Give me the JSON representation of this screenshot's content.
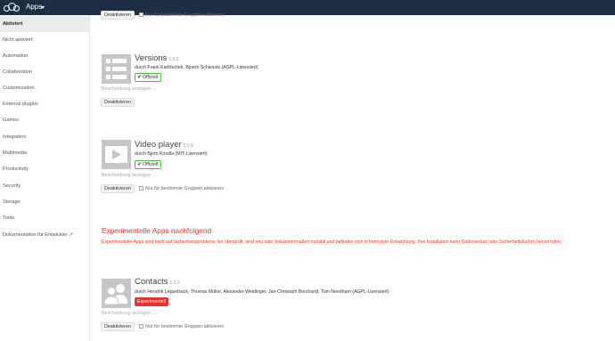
{
  "header": {
    "app_title": "Apps"
  },
  "sidebar": {
    "items": [
      {
        "label": "Aktiviert",
        "active": true
      },
      {
        "label": "Nicht aktiviert"
      },
      {
        "label": "Automation"
      },
      {
        "label": "Collaboration"
      },
      {
        "label": "Customization"
      },
      {
        "label": "External plugins"
      },
      {
        "label": "Games"
      },
      {
        "label": "Integration"
      },
      {
        "label": "Multimedia"
      },
      {
        "label": "Productivity"
      },
      {
        "label": "Security"
      },
      {
        "label": "Storage"
      },
      {
        "label": "Tools"
      },
      {
        "label": "Dokumentation für Entwickler ↗"
      }
    ]
  },
  "top_partial": {
    "button_label": "Deaktivieren",
    "checkbox_label": "Nur für bestimmte Gruppen aktivieren"
  },
  "apps": [
    {
      "name": "Versions",
      "version": "1.2.0",
      "authors": "durch Frank Karlitschek, Bjoern Schiessle (AGPL-Lizensiert)",
      "badge": "Offiziell",
      "description_link": "Beschreibung anzeigen ...",
      "button_label": "Deaktivieren",
      "icon": "versions-list-icon"
    },
    {
      "name": "Video player",
      "version": "0.9.8",
      "authors": "durch Bjorn Korella (MIT-Lizensiert)",
      "badge": "Offiziell",
      "description_link": "Beschreibung anzeigen ...",
      "button_label": "Deaktivieren",
      "checkbox_label": "Nur für bestimmte Gruppen aktivieren",
      "icon": "play-icon"
    },
    {
      "name": "Contacts",
      "version": "1.5.3",
      "authors": "durch Hendrik Leppelsack, Thomas Müller, Alexander Weidinger, Jan-Christoph Borchardt, Tom Needham (AGPL-Lizensiert)",
      "badge": "Experimentell",
      "description_link": "Beschreibung anzeigen ...",
      "button_label": "Deaktivieren",
      "checkbox_label": "Nur für bestimmte Gruppen aktivieren",
      "icon": "contacts-icon"
    }
  ],
  "experimental": {
    "heading": "Experimentelle Apps nachfolgend",
    "text": "Experimentelle Apps sind nicht auf Sicherheitsprobleme hin überprüft, sind neu oder bekanntermaßen instabil und befinden sich in intensiver Entwicklung. Ihre Installation kann Datenverlust oder Sicherheitslücken hervorrufen."
  },
  "colors": {
    "header_bg": "#1d2d44",
    "official_border": "#4cbf3f",
    "experimental_red": "#e9322d",
    "icon_gray": "#c6c6c6"
  }
}
